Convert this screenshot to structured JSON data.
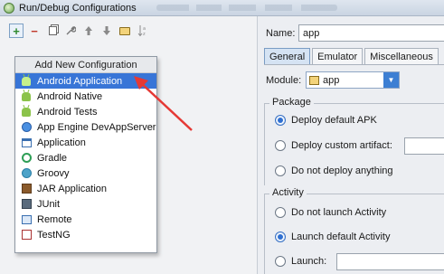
{
  "window": {
    "title": "Run/Debug Configurations"
  },
  "toolbar": {
    "add_symbol": "+",
    "remove_symbol": "−",
    "up_symbol": "🡑",
    "down_symbol": "🡓",
    "sort_symbol": "↓ª"
  },
  "popup": {
    "header": "Add New Configuration",
    "items": [
      {
        "label": "Android Application",
        "icon": "android-icon",
        "selected": true
      },
      {
        "label": "Android Native",
        "icon": "android-icon"
      },
      {
        "label": "Android Tests",
        "icon": "android-icon"
      },
      {
        "label": "App Engine DevAppServer",
        "icon": "app-engine-icon"
      },
      {
        "label": "Application",
        "icon": "application-icon"
      },
      {
        "label": "Gradle",
        "icon": "gradle-icon"
      },
      {
        "label": "Groovy",
        "icon": "groovy-icon"
      },
      {
        "label": "JAR Application",
        "icon": "jar-icon"
      },
      {
        "label": "JUnit",
        "icon": "junit-icon"
      },
      {
        "label": "Remote",
        "icon": "remote-icon"
      },
      {
        "label": "TestNG",
        "icon": "testng-icon"
      }
    ]
  },
  "config": {
    "name_label": "Name:",
    "name_value": "app",
    "tabs": [
      "General",
      "Emulator",
      "Miscellaneous"
    ],
    "module_label": "Module:",
    "module_value": "app",
    "package": {
      "title": "Package",
      "options": [
        "Deploy default APK",
        "Deploy custom artifact:",
        "Do not deploy anything"
      ]
    },
    "activity": {
      "title": "Activity",
      "options": [
        "Do not launch Activity",
        "Launch default Activity",
        "Launch:"
      ]
    }
  },
  "colors": {
    "selection": "#3875d7",
    "arrow": "#e53935"
  }
}
